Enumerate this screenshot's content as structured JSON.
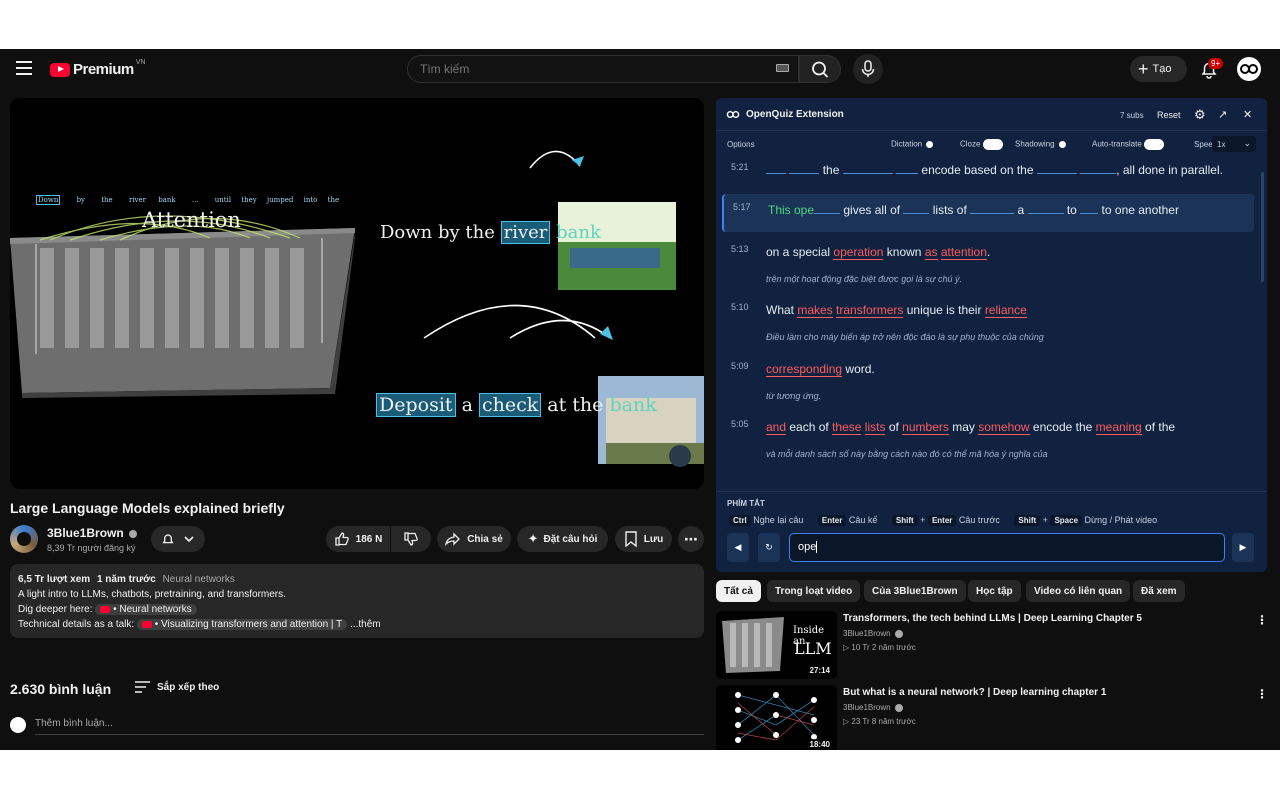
{
  "header": {
    "logo_text": "Premium",
    "region": "VN",
    "search_placeholder": "Tìm kiếm",
    "create_label": "Tạo",
    "notif_count": "9+"
  },
  "video": {
    "overlay": {
      "tokens": [
        "Down",
        "by",
        "the",
        "river",
        "bank",
        "...",
        "until",
        "they",
        "jumped",
        "into",
        "the"
      ],
      "attention_label": "Attention",
      "s1_a": "Down by the",
      "s1_b": "river",
      "s1_c": "bank",
      "s2_a": "Deposit",
      "s2_b": "a",
      "s2_c": "check",
      "s2_d": "at the",
      "s2_e": "bank"
    },
    "title": "Large Language Models explained briefly",
    "channel": "3Blue1Brown",
    "subs": "8,39 Tr người đăng ký",
    "likes": "186 N",
    "share": "Chia sẻ",
    "ask": "Đặt câu hỏi",
    "save": "Lưu"
  },
  "description": {
    "views": "6,5 Tr lượt xem",
    "age": "1 năm trước",
    "tag": "Neural networks",
    "line1": "A light intro to LLMs, chatbots, pretraining, and transformers.",
    "line2_label": "Dig deeper here:",
    "line2_link": "• Neural networks",
    "line3_label": "Technical details as a talk:",
    "line3_link": "• Visualizing transformers and attention | T",
    "more": "...thêm"
  },
  "comments": {
    "count": "2.630 bình luận",
    "sort": "Sắp xếp theo",
    "placeholder": "Thêm bình luận..."
  },
  "quiz": {
    "title": "OpenQuiz Extension",
    "subs_count": "7 subs",
    "reset": "Reset",
    "options_label": "Options",
    "dictation": "Dictation",
    "cloze": "Cloze",
    "shadowing": "Shadowing",
    "autotranslate": "Auto-translate",
    "speed_label": "Speed",
    "speed_value": "1x",
    "subs": [
      {
        "time": "5:21",
        "translation": ""
      },
      {
        "time": "5:17",
        "translation": ""
      },
      {
        "time": "5:13",
        "translation": "trên một hoạt động đặc biệt được gọi là sự chú ý."
      },
      {
        "time": "5:10",
        "translation": "Điều làm cho máy biến áp trở nên độc đáo là sự phụ thuộc của chúng"
      },
      {
        "time": "5:09",
        "translation": "từ tương ứng."
      },
      {
        "time": "5:05",
        "translation": "và mỗi danh sách số này bằng cách nào đó có thể mã hóa ý nghĩa của"
      }
    ],
    "w": {
      "s1_the": "the",
      "s1_encode": "encode based on the",
      "s1_end": ", all done in parallel.",
      "s2_this": "This ope",
      "s2_gives": "gives all of",
      "s2_lists": "lists of",
      "s2_a": "a",
      "s2_to": "to",
      "s2_end": "to one another",
      "s3_on": "on a special",
      "s3_operation": "operation",
      "s3_known": "known",
      "s3_as": "as",
      "s3_attention": "attention",
      "s3_dot": ".",
      "s4_what": "What",
      "s4_makes": "makes",
      "s4_transformers": "transformers",
      "s4_unique": "unique is their",
      "s4_reliance": "reliance",
      "s5_corr": "corresponding",
      "s5_word": "word.",
      "s6_and": "and",
      "s6_each": "each of",
      "s6_these": "these",
      "s6_lists": "lists",
      "s6_of": "of",
      "s6_numbers": "numbers",
      "s6_may": "may",
      "s6_somehow": "somehow",
      "s6_encode": "encode the",
      "s6_meaning": "meaning",
      "s6_ofthe": "of the"
    },
    "shortcuts_label": "PHÍM TẮT",
    "sc": {
      "ctrl": "Ctrl",
      "ctrl_desc": "Nghe lại câu",
      "enter": "Enter",
      "enter_desc": "Câu kế",
      "shift": "Shift",
      "plus": "+",
      "enter2": "Enter",
      "shift_enter_desc": "Câu trước",
      "shift2": "Shift",
      "plus2": "+",
      "space": "Space",
      "space_desc": "Dừng / Phát video"
    },
    "input_value": "ope"
  },
  "filters": [
    "Tất cả",
    "Trong loạt video",
    "Của 3Blue1Brown",
    "Học tập",
    "Video có liên quan",
    "Đã xem"
  ],
  "related": [
    {
      "title": "Transformers, the tech behind LLMs | Deep Learning Chapter 5",
      "channel": "3Blue1Brown",
      "stats": "10 Tr   2 năm trước",
      "duration": "27:14",
      "thumb_a": "Inside an",
      "thumb_b": "LLM"
    },
    {
      "title": "But what is a neural network? | Deep learning chapter 1",
      "channel": "3Blue1Brown",
      "stats": "23 Tr   8 năm trước",
      "duration": "18:40"
    }
  ],
  "colors": {
    "accent": "#3b82f6",
    "panel": "#112240",
    "highlight_red": "#ff5c5c",
    "highlight_green": "#4cd97b"
  }
}
